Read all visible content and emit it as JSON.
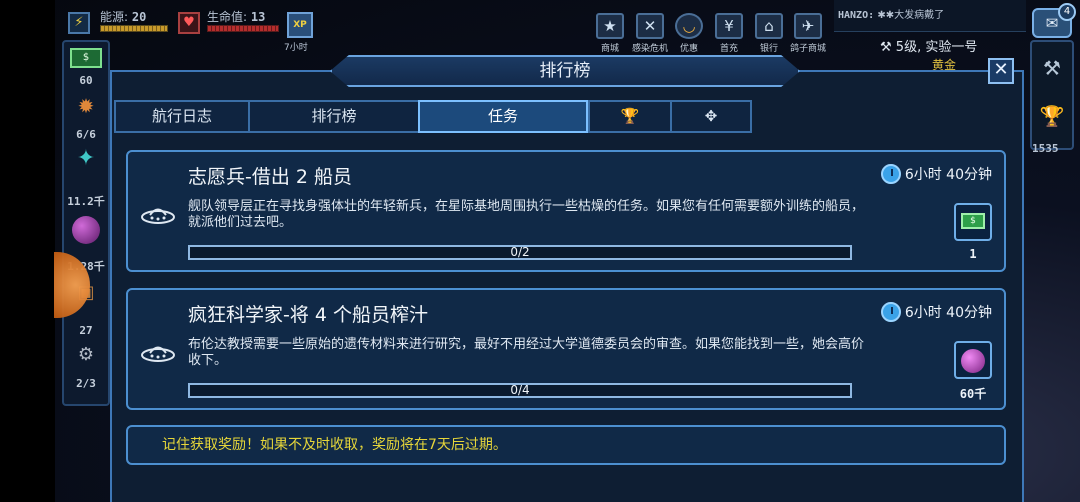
{
  "hud": {
    "energy_label": "能源:",
    "energy_value": "20",
    "health_label": "生命值:",
    "health_value": "13",
    "xp_icon": "XP",
    "timer": "7小时"
  },
  "sidebar": {
    "energy_value": "60",
    "crew_value": "6/6",
    "crystal_value": "11.2千",
    "orb_value": "1.28千",
    "item_value": "27",
    "parts_value": "2/3"
  },
  "topmenu": [
    "商城",
    "感染危机",
    "优惠",
    "首充",
    "银行",
    "鸽子商城"
  ],
  "chat": {
    "sender": "HANZO:",
    "message": "✱✱大发病戴了",
    "badge": "4"
  },
  "player": {
    "rank": "5级, 实验一号",
    "gold": "黄金"
  },
  "right": {
    "trophy_count": "1535"
  },
  "modal": {
    "title": "排行榜",
    "close": "✕"
  },
  "tabs": [
    {
      "label": "航行日志"
    },
    {
      "label": "排行榜"
    },
    {
      "label": "任务"
    },
    {
      "label": "🏆"
    },
    {
      "label": "✥"
    }
  ],
  "missions": [
    {
      "title": "志愿兵-借出 2 船员",
      "description": "舰队领导层正在寻找身强体壮的年轻新兵，在星际基地周围执行一些枯燥的任务。如果您有任何需要额外训练的船员，就派他们过去吧。",
      "time": "6小时 40分钟",
      "progress": "0/2",
      "progress_fraction": 0,
      "reward_label": "1",
      "reward_icon": "cash-icon"
    },
    {
      "title": "疯狂科学家-将 4 个船员榨汁",
      "description": "布伦达教授需要一些原始的遗传材料来进行研究，最好不用经过大学道德委员会的审查。如果您能找到一些，她会高价收下。",
      "time": "6小时 40分钟",
      "progress": "0/4",
      "progress_fraction": 0,
      "reward_label": "60千",
      "reward_icon": "orb-icon"
    }
  ],
  "notice": "记住获取奖励！如果不及时收取，奖励将在7天后过期。",
  "colors": {
    "accent": "#4c8fd0",
    "notice": "#e6d63a",
    "panel": "#102947"
  }
}
